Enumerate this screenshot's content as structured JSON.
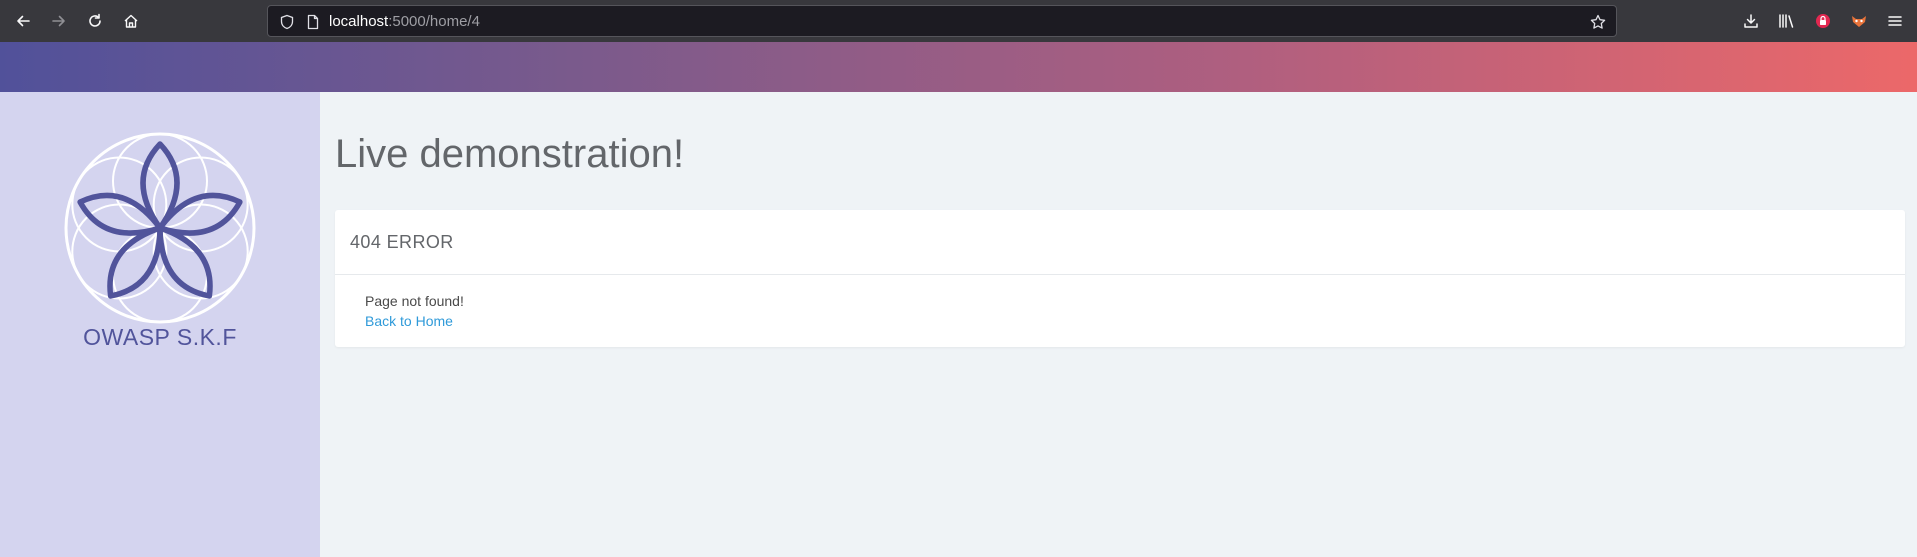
{
  "browser": {
    "url_host": "localhost",
    "url_path": ":5000/home/4",
    "icons": {
      "back": "back-arrow-icon",
      "forward": "forward-arrow-icon",
      "reload": "reload-icon",
      "home": "home-icon",
      "shield": "tracking-shield-icon",
      "page": "page-icon",
      "bookmark": "bookmark-star-icon",
      "downloads": "downloads-icon",
      "library": "library-icon",
      "extension_1": "lock-extension-icon",
      "extension_2": "fox-extension-icon",
      "menu": "hamburger-menu-icon"
    }
  },
  "sidebar": {
    "logo_text": "OWASP S.K.F"
  },
  "main": {
    "title": "Live demonstration!",
    "card": {
      "header": "404 ERROR",
      "message": "Page not found!",
      "link_label": "Back to Home"
    }
  },
  "colors": {
    "sidebar_bg": "#d4d4ef",
    "logo": "#51549b",
    "link": "#2f9ad9",
    "banner_start": "#51519a",
    "banner_end": "#ec6869"
  }
}
